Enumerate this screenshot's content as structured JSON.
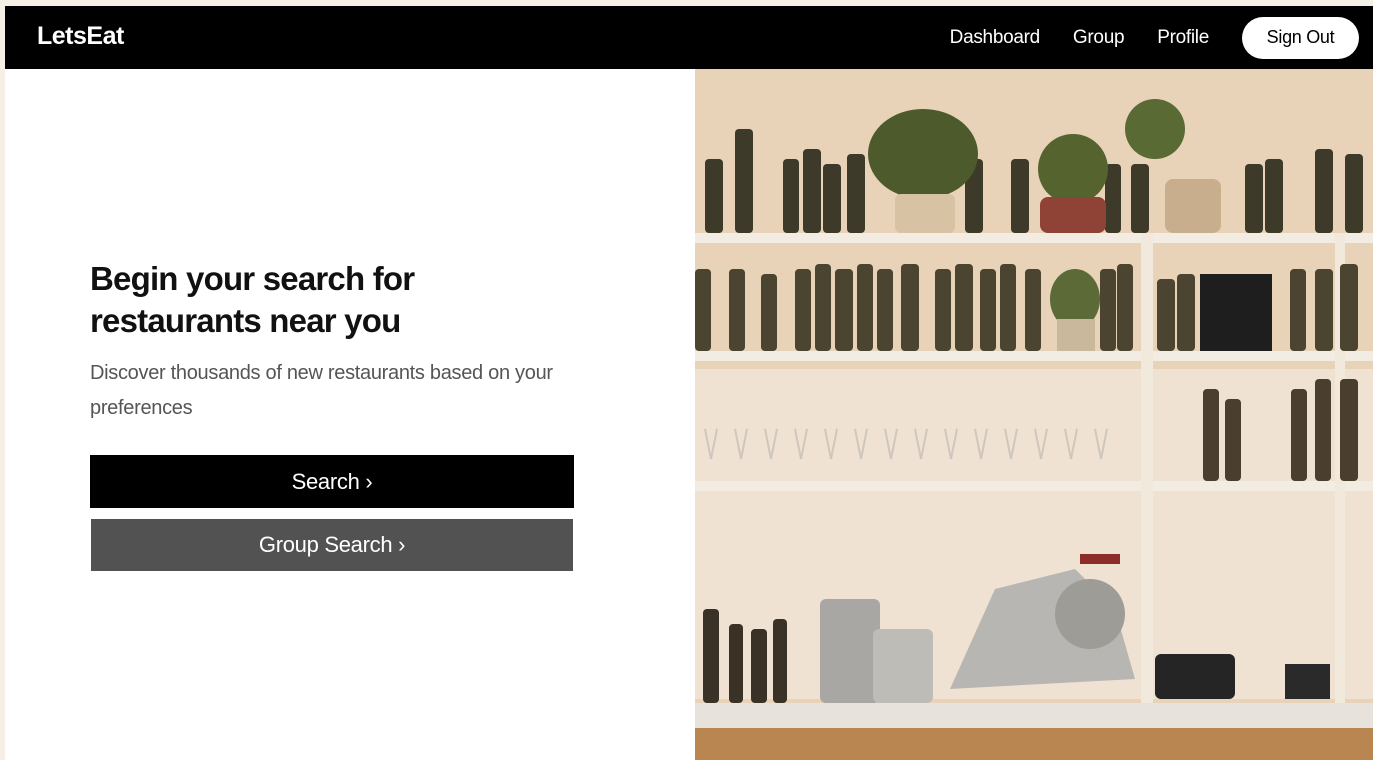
{
  "brand": {
    "logo": "LetsEat"
  },
  "nav": {
    "links": [
      "Dashboard",
      "Group",
      "Profile"
    ],
    "sign_out": "Sign Out"
  },
  "hero": {
    "title": "Begin your search for restaurants near you",
    "subtitle": "Discover thousands of new restaurants based on your preferences",
    "search_button": "Search ›",
    "group_search_button": "Group Search ›"
  },
  "image": {
    "icon": "restaurant-bar-photo"
  },
  "colors": {
    "nav_bg": "#000000",
    "primary_button": "#000000",
    "secondary_button": "#525252",
    "page_bg": "#f6efe6"
  }
}
